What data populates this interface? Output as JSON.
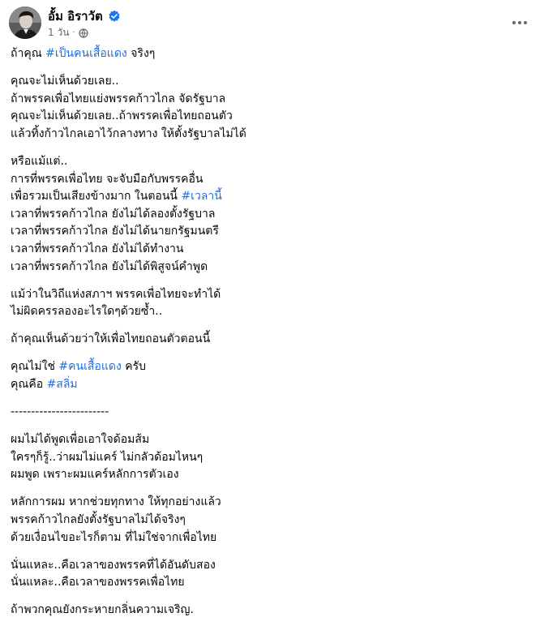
{
  "post": {
    "author": "อั้ม อิราวัต",
    "time": "1 วัน",
    "dot": "·",
    "accent_color": "#216fdb",
    "verified_icon": "verified-badge-icon",
    "privacy_icon": "globe-icon",
    "more_icon": "more-options-icon"
  },
  "content": {
    "p1": {
      "pre": "ถ้าคุณ ",
      "tag": "#เป็นคนเสื้อแดง",
      "post": " จริงๆ"
    },
    "p2": [
      "คุณจะไม่เห็นด้วยเลย..",
      "ถ้าพรรคเพื่อไทยแย่งพรรคก้าวไกล จัดรัฐบาล",
      "คุณจะไม่เห็นด้วยเลย..ถ้าพรรคเพื่อไทยถอนตัว",
      "แล้วทิ้งก้าวไกลเอาไว้กลางทาง ให้ตั้งรัฐบาลไม่ได้"
    ],
    "p3": {
      "l1": "หรือแม้แต่..",
      "l2": "การที่พรรคเพื่อไทย จะจับมือกับพรรคอื่น",
      "l3_pre": "เพื่อรวมเป็นเสียงข้างมาก ในตอนนี้ ",
      "l3_tag": "#เวลานี้",
      "l4": "เวลาที่พรรคก้าวไกล ยังไม่ได้ลองตั้งรัฐบาล",
      "l5": "เวลาที่พรรคก้าวไกล ยังไม่ได้นายกรัฐมนตรี",
      "l6": "เวลาที่พรรคก้าวไกล ยังไม่ได้ทำงาน",
      "l7": "เวลาที่พรรคก้าวไกล ยังไม่ได้พิสูจน์คำพูด"
    },
    "p4": [
      "แม้ว่าในวิถีแห่งสภาฯ พรรคเพื่อไทยจะทำได้",
      "ไม่ผิดครรลองอะไรใดๆด้วยซ้ำ.."
    ],
    "p5": "ถ้าคุณเห็นด้วยว่าให้เพื่อไทยถอนตัวตอนนี้",
    "p6": {
      "l1_pre": "คุณไม่ใช่ ",
      "l1_tag": "#คนเสื้อแดง",
      "l1_post": " ครับ",
      "l2_pre": "คุณคือ ",
      "l2_tag": "#สลิ่ม"
    },
    "divider": "------------------------",
    "p7": [
      "ผมไม่ได้พูดเพื่อเอาใจด้อมส้ม",
      "ใครๆก็รู้..ว่าผมไม่แคร์ ไม่กลัวด้อมไหนๆ",
      "ผมพูด เพราะผมแคร์หลักการตัวเอง"
    ],
    "p8": [
      "หลักการผม หากช่วยทุกทาง ให้ทุกอย่างแล้ว",
      "พรรคก้าวไกลยังตั้งรัฐบาลไม่ได้จริงๆ",
      "ด้วยเงื่อนไขอะไรก็ตาม ที่ไม่ใช่จากเพื่อไทย"
    ],
    "p9": [
      "นั่นแหละ..คือเวลาของพรรคที่ได้อันดับสอง",
      "นั่นแหละ..คือเวลาของพรรคเพื่อไทย"
    ],
    "p10": "ถ้าพวกคุณยังกระหายกลิ่นความเจริญ."
  }
}
